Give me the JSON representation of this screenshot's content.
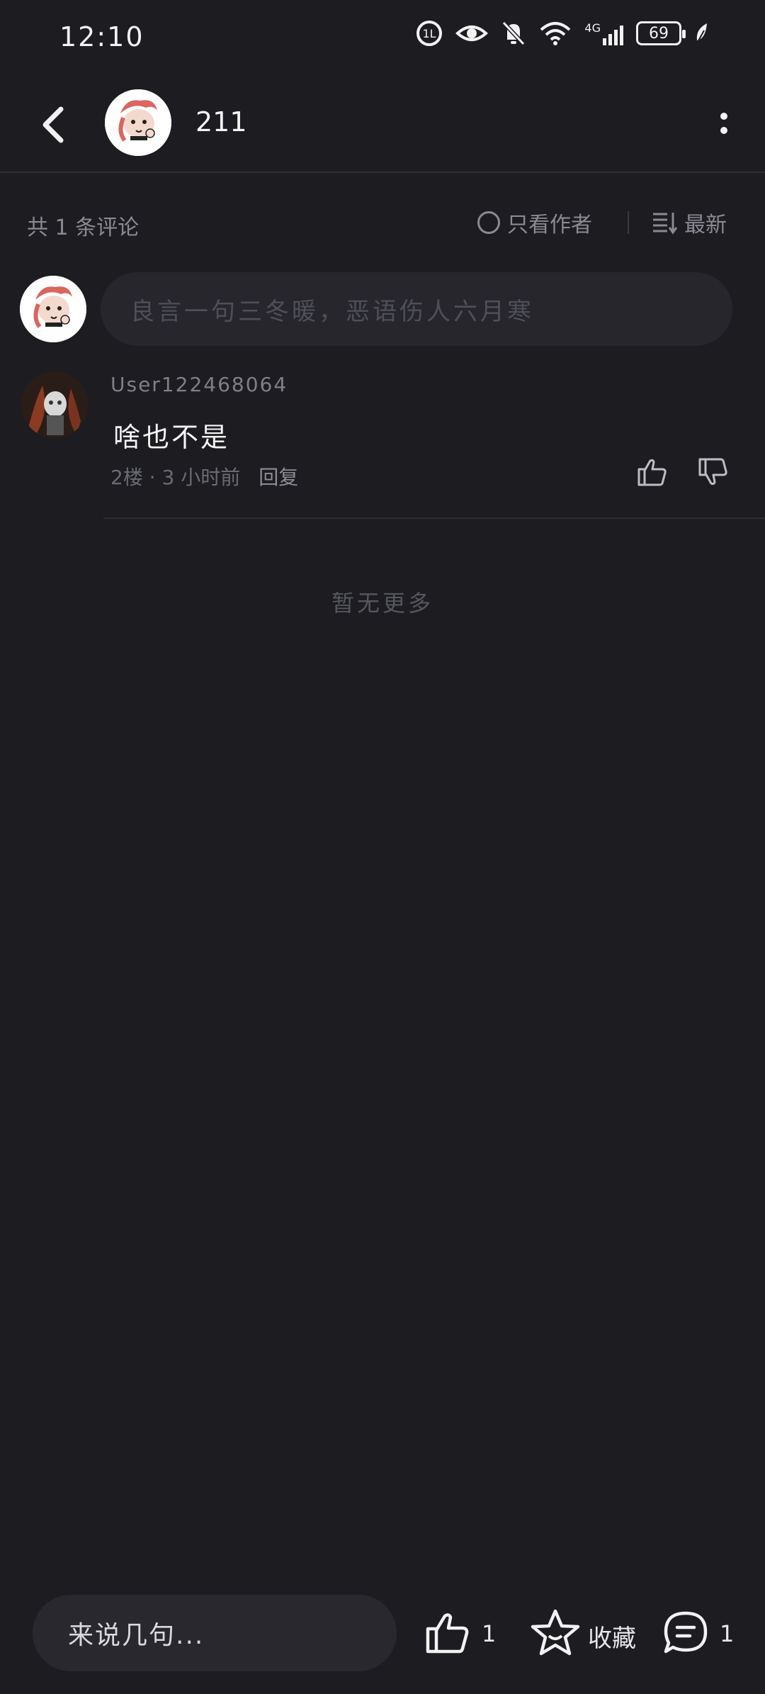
{
  "status_bar": {
    "time": "12:10",
    "network": "4G",
    "battery": "69"
  },
  "header": {
    "title": "211"
  },
  "comments_header": {
    "count_text": "共 1 条评论",
    "only_author_label": "只看作者",
    "sort_label": "最新"
  },
  "composer": {
    "placeholder": "良言一句三冬暖，恶语伤人六月寒"
  },
  "comments": [
    {
      "user": "User122468064",
      "text": "啥也不是",
      "floor": "2楼 · 3 小时前",
      "reply_label": "回复"
    }
  ],
  "list_end_text": "暂无更多",
  "bottom_bar": {
    "input_placeholder": "来说几句...",
    "like_count": "1",
    "favorite_label": "收藏",
    "comment_count": "1"
  },
  "colors": {
    "background": "#1c1c21",
    "input_background": "#26262c",
    "muted_text": "#8a8a93"
  }
}
